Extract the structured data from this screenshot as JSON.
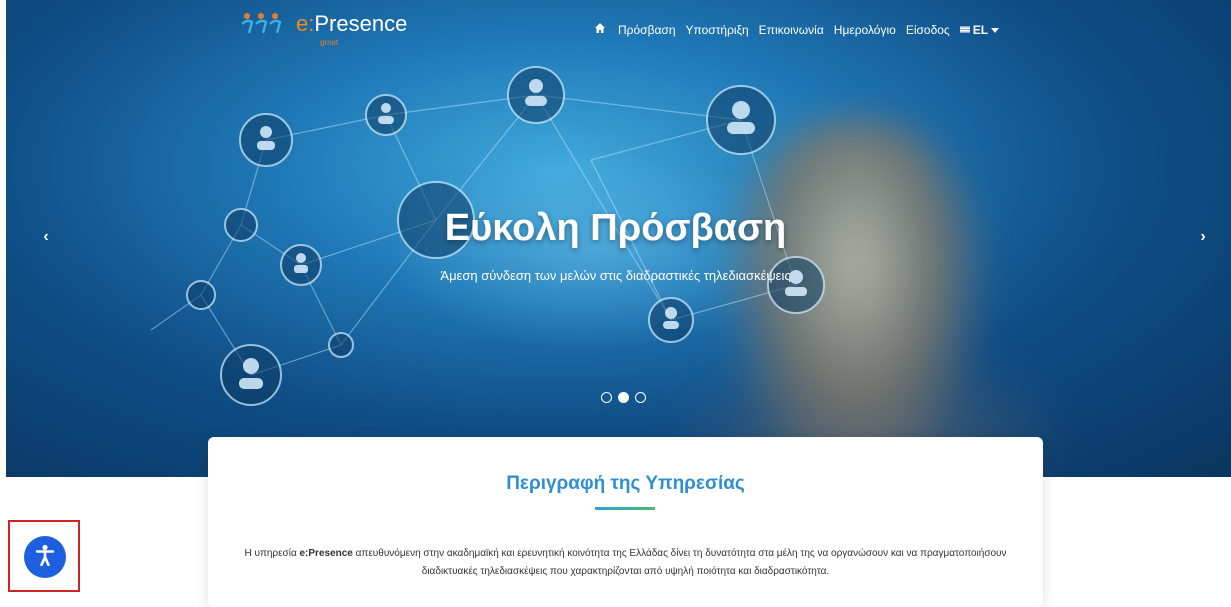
{
  "nav": {
    "logo_text_e": "e:",
    "logo_text_rest": "Presence",
    "logo_sub": "grnet",
    "home_icon": "home-icon",
    "items": [
      "Πρόσβαση",
      "Υποστήριξη",
      "Επικοινωνία",
      "Ημερολόγιο",
      "Είσοδος"
    ],
    "lang": "EL"
  },
  "hero": {
    "title": "Εύκολη Πρόσβαση",
    "subtitle": "Άμεση σύνδεση των μελών στις διαδραστικές τηλεδιασκέψεις",
    "prev": "‹",
    "next": "›",
    "active_slide": 2
  },
  "card": {
    "title": "Περιγραφή της Υπηρεσίας",
    "text_before": "Η υπηρεσία ",
    "text_bold": "e:Presence",
    "text_after": " απευθυνόμενη στην ακαδημαϊκή και ερευνητική κοινότητα της Ελλάδας δίνει τη δυνατότητα στα μέλη της να οργανώσουν και να πραγματοποιήσουν διαδικτυακές τηλεδιασκέψεις που χαρακτηρίζονται από υψηλή ποιότητα και διαδραστικότητα."
  },
  "colors": {
    "accent": "#2f8fd0",
    "a11y": "#1e5fe0",
    "logo_orange": "#e87e2a"
  }
}
